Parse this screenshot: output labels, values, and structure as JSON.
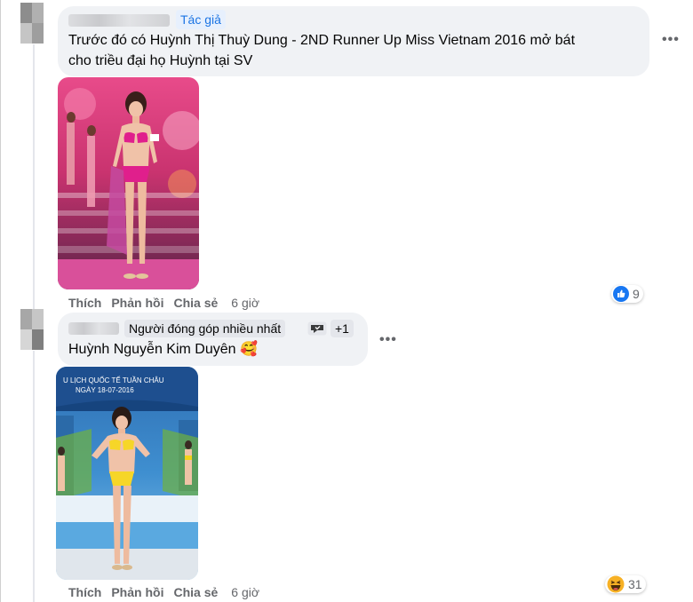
{
  "comments": [
    {
      "badge": "Tác giả",
      "lines": [
        "Trước đó có Huỳnh Thị Thuỳ Dung - 2ND Runner Up Miss Vietnam 2016 mở bát",
        "cho triều đại họ Huỳnh tại SV"
      ],
      "actions": {
        "like": "Thích",
        "reply": "Phản hồi",
        "share": "Chia sẻ",
        "time": "6 giờ"
      },
      "reaction": {
        "icon": "like-reaction-icon",
        "count": "9"
      },
      "more": "•••"
    },
    {
      "badge": "Người đóng góp nhiều nhất",
      "extra_badge": "+1",
      "text": "Huỳnh Nguyễn Kim Duyên",
      "emoji": "🥰",
      "actions": {
        "like": "Thích",
        "reply": "Phản hồi",
        "share": "Chia sẻ",
        "time": "6 giờ"
      },
      "reaction": {
        "icon": "haha-reaction-icon",
        "count": "31"
      },
      "more": "•••"
    }
  ],
  "photo2_sign": "U LỊCH QUỐC TẾ TUẦN CHÂU\nNGÀY 18-07-2016",
  "colors": {
    "like_blue": "#1877f2",
    "haha_yellow": "#f7b125",
    "badge_blue": "#1b74e4"
  }
}
